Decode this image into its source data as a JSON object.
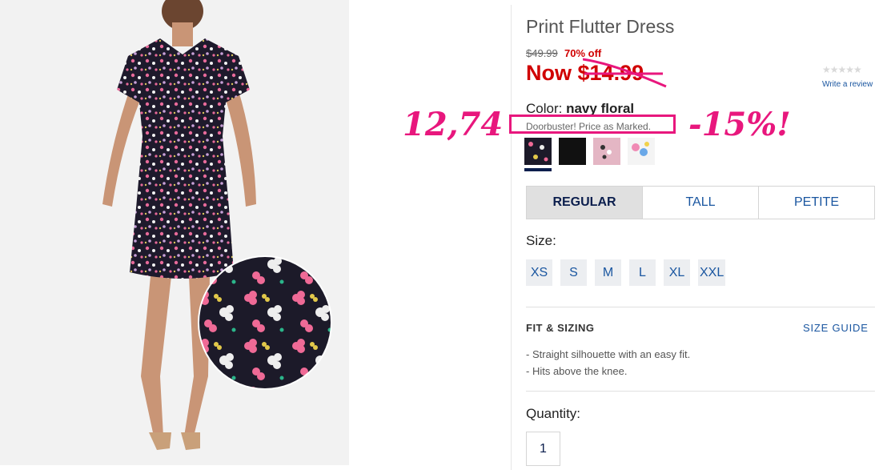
{
  "product": {
    "title": "Print Flutter Dress",
    "was_price": "$49.99",
    "percent_off": "70% off",
    "now_prefix": "Now",
    "now_price": "$14.99",
    "write_review": "Write a review",
    "rating_stars": "★★★★★",
    "rating_value": 0
  },
  "color": {
    "label": "Color:",
    "value": "navy floral",
    "promo": "Doorbuster! Price as Marked.",
    "swatches": [
      {
        "name": "navy floral",
        "selected": true
      },
      {
        "name": "black",
        "selected": false
      },
      {
        "name": "pink floral",
        "selected": false
      },
      {
        "name": "white floral",
        "selected": false
      }
    ]
  },
  "annotations": {
    "left": "12,74",
    "right": "-15%!",
    "accent_color": "#e8177d"
  },
  "fit_tabs": [
    {
      "label": "REGULAR",
      "active": true
    },
    {
      "label": "TALL",
      "active": false
    },
    {
      "label": "PETITE",
      "active": false
    }
  ],
  "size": {
    "label": "Size:",
    "options": [
      "XS",
      "S",
      "M",
      "L",
      "XL",
      "XXL"
    ]
  },
  "fit_sizing": {
    "heading": "FIT & SIZING",
    "size_guide": "SIZE GUIDE",
    "bullets": [
      "Straight silhouette with an easy fit.",
      "Hits above the knee."
    ]
  },
  "quantity": {
    "label": "Quantity:",
    "value": "1"
  },
  "colors": {
    "sale_red": "#d00000",
    "link_blue": "#1a56a0",
    "navy": "#0b1e4d"
  }
}
